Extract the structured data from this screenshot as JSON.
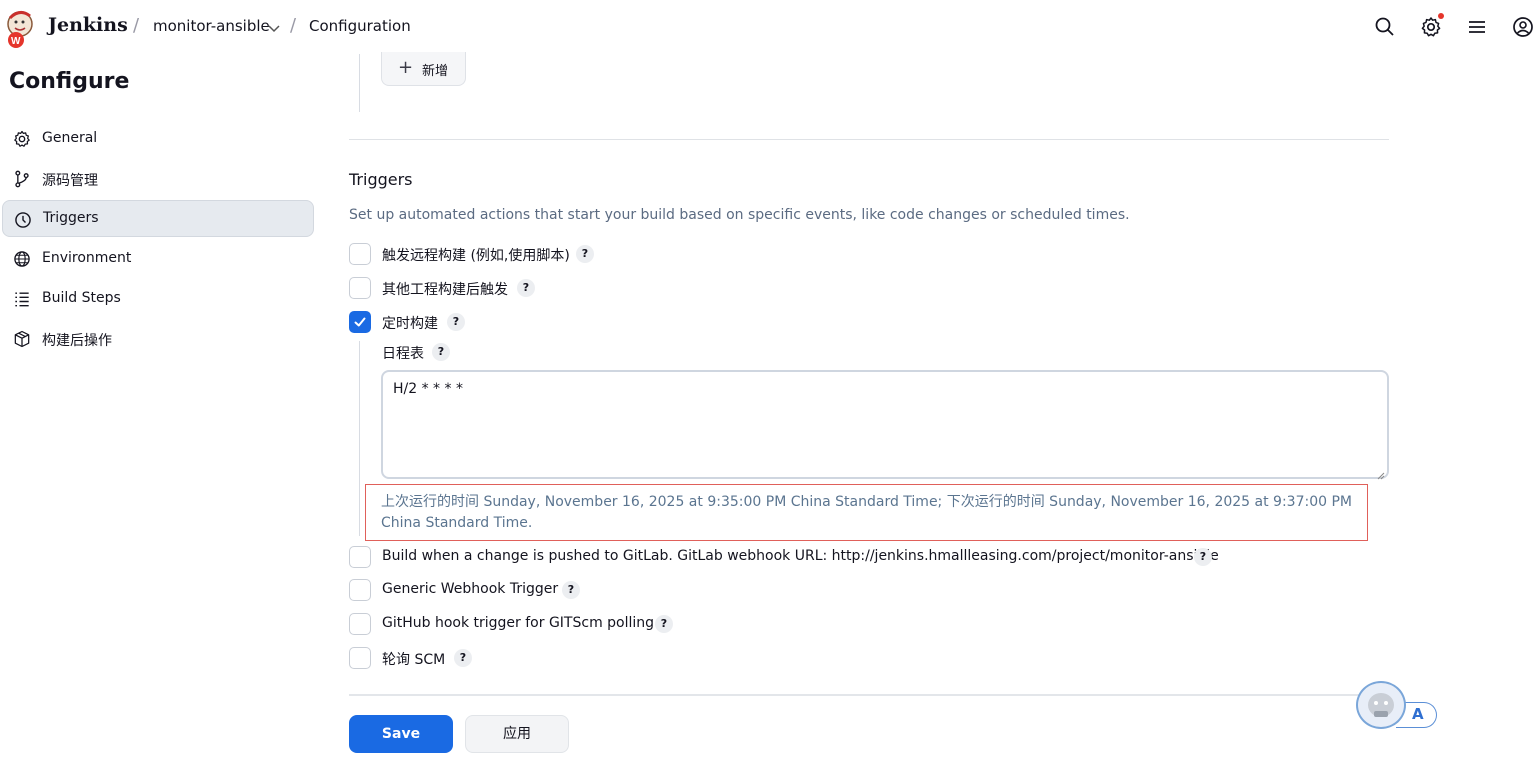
{
  "header": {
    "brand": "Jenkins",
    "crumbs": [
      "monitor-ansible",
      "Configuration"
    ],
    "separator": "/"
  },
  "sidebar": {
    "title": "Configure",
    "items": [
      {
        "label": "General",
        "icon": "gear-icon"
      },
      {
        "label": "源码管理",
        "icon": "git-branch-icon"
      },
      {
        "label": "Triggers",
        "icon": "clock-icon",
        "active": true
      },
      {
        "label": "Environment",
        "icon": "globe-icon"
      },
      {
        "label": "Build Steps",
        "icon": "list-icon"
      },
      {
        "label": "构建后操作",
        "icon": "package-icon"
      }
    ]
  },
  "main": {
    "add_button": {
      "plus": "+",
      "label": "新增"
    },
    "triggers": {
      "title": "Triggers",
      "description": "Set up automated actions that start your build based on specific events, like code changes or scheduled times.",
      "options": [
        {
          "label": "触发远程构建 (例如,使用脚本)",
          "checked": false
        },
        {
          "label": "其他工程构建后触发",
          "checked": false
        },
        {
          "label": "定时构建",
          "checked": true
        },
        {
          "label": "Build when a change is pushed to GitLab. GitLab webhook URL: http://jenkins.hmallleasing.com/project/monitor-ansible",
          "checked": false
        },
        {
          "label": "Generic Webhook Trigger",
          "checked": false
        },
        {
          "label": "GitHub hook trigger for GITScm polling",
          "checked": false
        },
        {
          "label": "轮询 SCM",
          "checked": false
        }
      ],
      "help_glyph": "?",
      "schedule": {
        "label": "日程表",
        "value": "H/2 * * * *",
        "note": "上次运行的时间 Sunday, November 16, 2025 at 9:35:00 PM China Standard Time; 下次运行的时间 Sunday, November 16, 2025 at 9:37:00 PM China Standard Time."
      }
    }
  },
  "footer": {
    "save_label": "Save",
    "apply_label": "应用"
  },
  "assistant": {
    "letter": "A"
  },
  "colors": {
    "accent": "#1a6ae3",
    "note_border": "#e0605a",
    "note_text": "#5b7590",
    "description": "#5b6b82"
  }
}
